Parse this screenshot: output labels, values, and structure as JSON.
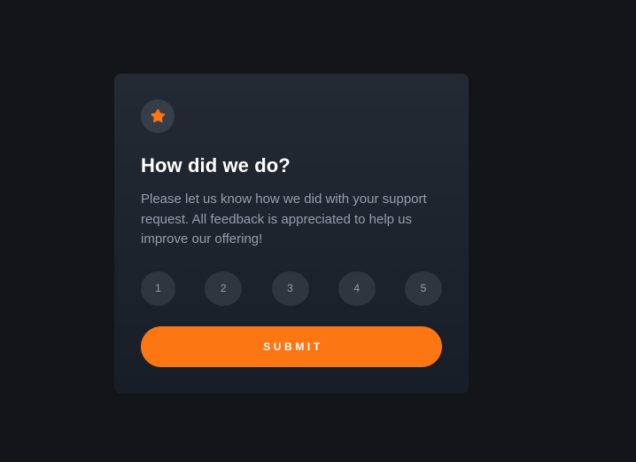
{
  "card": {
    "icon": "star-icon",
    "title": "How did we do?",
    "description": "Please let us know how we did with your support request. All feedback is appreciated to help us improve our offering!",
    "ratings": [
      "1",
      "2",
      "3",
      "4",
      "5"
    ],
    "submit_label": "SUBMIT"
  },
  "colors": {
    "page_background": "#131518",
    "card_background": "#232a34",
    "accent": "#fc7614",
    "rating_background": "#2f3640",
    "muted_text": "#959eac"
  }
}
